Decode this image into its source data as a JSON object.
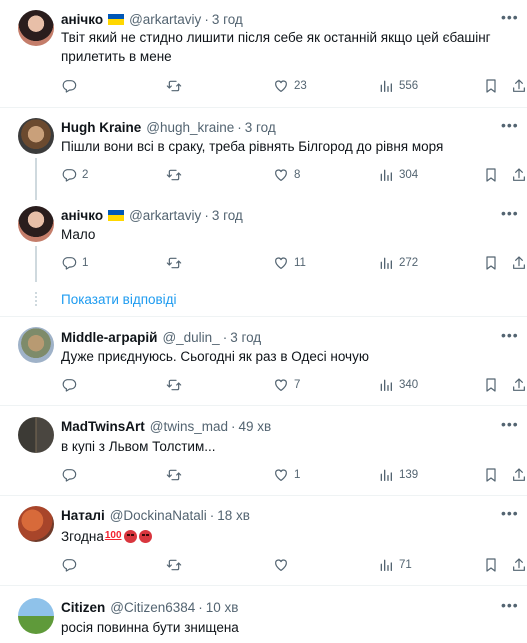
{
  "tweets": [
    {
      "name": "анічко",
      "handle": "@arkartaviy",
      "time": "3 год",
      "flag": true,
      "text": "Твіт який не стидно лишити після себе як останній якщо цей єбашінг прилетить в мене",
      "reply_count": "",
      "retweet_count": "",
      "like_count": "23",
      "view_count": "556"
    },
    {
      "name": "Hugh Kraine",
      "handle": "@hugh_kraine",
      "time": "3 год",
      "flag": false,
      "text": "Пішли вони всі в сраку, треба рівнять Білгород до рівня моря",
      "reply_count": "2",
      "retweet_count": "",
      "like_count": "8",
      "view_count": "304"
    },
    {
      "name": "анічко",
      "handle": "@arkartaviy",
      "time": "3 год",
      "flag": true,
      "text": "Мало",
      "reply_count": "1",
      "retweet_count": "",
      "like_count": "11",
      "view_count": "272"
    },
    {
      "name": "Middle-аграрій",
      "handle": "@_dulin_",
      "time": "3 год",
      "flag": false,
      "text": "Дуже приєднуюсь. Сьогодні як раз в Одесі ночую",
      "reply_count": "",
      "retweet_count": "",
      "like_count": "7",
      "view_count": "340"
    },
    {
      "name": "MadTwinsArt",
      "handle": "@twins_mad",
      "time": "49 хв",
      "flag": false,
      "text": "в купі з Львом Толстим...",
      "reply_count": "",
      "retweet_count": "",
      "like_count": "1",
      "view_count": "139"
    },
    {
      "name": "Наталі",
      "handle": "@DockinaNatali",
      "time": "18 хв",
      "flag": false,
      "text": "Згодна",
      "emoji_100": "100",
      "reply_count": "",
      "retweet_count": "",
      "like_count": "",
      "view_count": "71"
    },
    {
      "name": "Citizen",
      "handle": "@Citizen6384",
      "time": "10 хв",
      "flag": false,
      "text": "росія повинна бути знищена"
    }
  ],
  "show_replies_label": "Показати відповіді",
  "separator": "·",
  "colors": {
    "accent": "#1d9bf0",
    "secondary_text": "#536471",
    "border": "#eff3f4"
  },
  "icons": [
    "reply-icon",
    "retweet-icon",
    "like-icon",
    "views-icon",
    "bookmark-icon",
    "share-icon",
    "more-icon"
  ]
}
